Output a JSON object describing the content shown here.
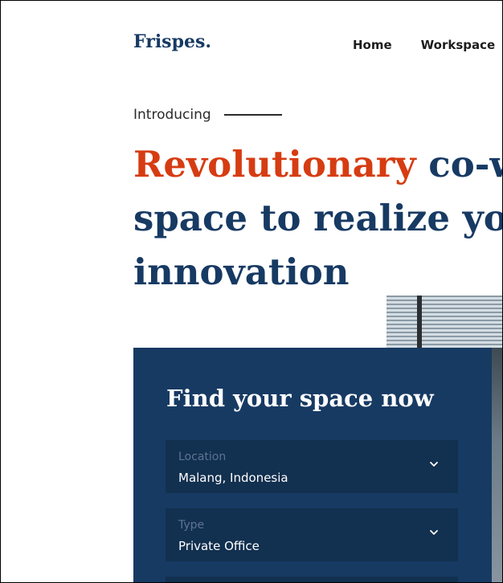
{
  "header": {
    "brand": "Frispes.",
    "nav": [
      "Home",
      "Workspace"
    ]
  },
  "hero": {
    "intro": "Introducing",
    "headline_accent": "Revolutionary",
    "headline_line1_rest": " co-w",
    "headline_line2": "space to realize yo",
    "headline_line3": "innovation"
  },
  "search_card": {
    "title": "Find your space now",
    "fields": [
      {
        "label": "Location",
        "value": "Malang, Indonesia",
        "icon": "chevron-down-icon"
      },
      {
        "label": "Type",
        "value": "Private Office",
        "icon": "chevron-down-icon"
      }
    ]
  },
  "colors": {
    "brand_navy": "#173a63",
    "accent_orange": "#d63c12",
    "field_bg": "#12304f",
    "label_muted": "#5d7492"
  }
}
